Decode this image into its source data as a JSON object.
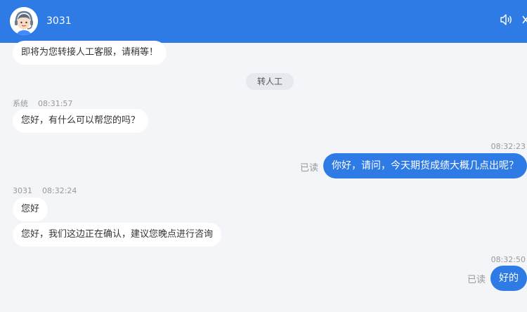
{
  "header": {
    "agent_name": "3031",
    "bg_color": "#2f7be5",
    "icons": [
      "agent-avatar",
      "speaker-icon",
      "close-icon"
    ]
  },
  "messages": {
    "m1": {
      "text": "即将为您转接人工客服，请稍等！"
    },
    "system_notice": "转人工",
    "m2": {
      "sender": "系统",
      "time": "08:31:57",
      "text": "您好，有什么可以帮您的吗？"
    },
    "m3": {
      "time": "08:32:23",
      "status": "已读",
      "text": "你好，请问，今天期货成绩大概几点出呢？"
    },
    "m4": {
      "sender": "3031",
      "time": "08:32:24",
      "text": "您好"
    },
    "m5": {
      "text": "您好，我们这边正在确认，建议您晚点进行咨询"
    },
    "m6": {
      "time": "08:32:50",
      "status": "已读",
      "text": "好的"
    }
  }
}
